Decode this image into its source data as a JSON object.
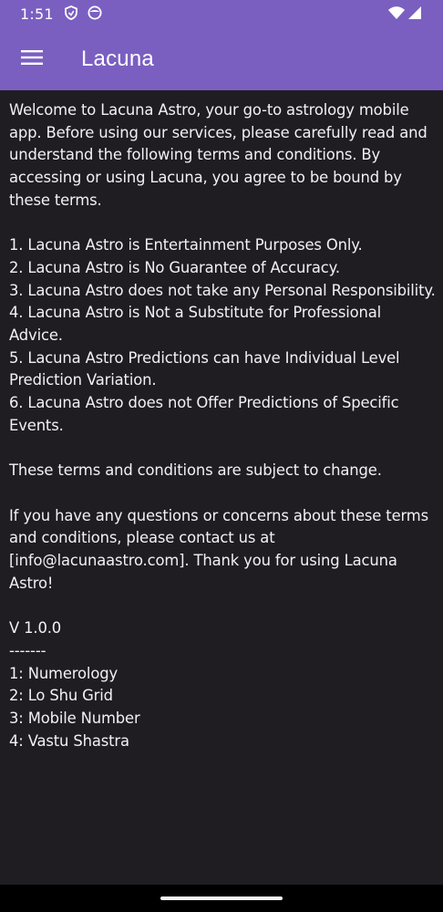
{
  "status_bar": {
    "time": "1:51"
  },
  "app_bar": {
    "title": "Lacuna"
  },
  "content": {
    "intro": "Welcome to Lacuna Astro, your go-to astrology mobile app. Before using our services, please carefully read and understand the following terms and conditions. By accessing or using Lacuna, you agree to be bound by these terms.",
    "terms": [
      "1. Lacuna Astro is Entertainment Purposes Only.",
      "2. Lacuna Astro is No Guarantee of Accuracy.",
      "3. Lacuna Astro does not take any Personal Responsibility.",
      "4. Lacuna Astro is Not a Substitute for Professional Advice.",
      "5. Lacuna Astro Predictions can have Individual Level Prediction Variation.",
      "6. Lacuna Astro does not Offer Predictions of Specific Events."
    ],
    "change_notice": "These terms and conditions are subject to change.",
    "contact": "If you have any questions or concerns about these terms and conditions, please contact us at [info@lacunaastro.com]. Thank you for using Lacuna Astro!",
    "version": "V 1.0.0",
    "separator": "-------",
    "features": [
      "1: Numerology",
      "2: Lo Shu Grid",
      "3: Mobile Number",
      "4: Vastu Shastra"
    ]
  },
  "colors": {
    "app_bar": "#7a5fc1",
    "background": "#1f1d22",
    "text": "#f2f0f4"
  },
  "icons": {
    "menu": "menu-icon",
    "shield": "shield-icon",
    "notification": "face-icon",
    "wifi": "wifi-icon",
    "signal": "signal-icon"
  }
}
